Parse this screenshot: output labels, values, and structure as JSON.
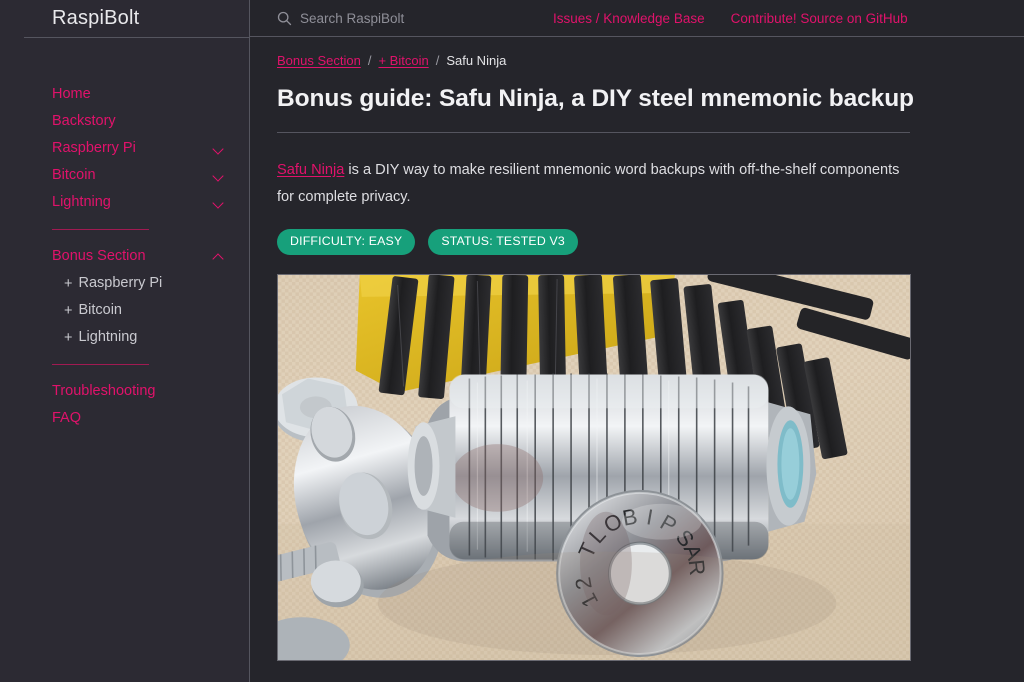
{
  "sidebar": {
    "brand": "RaspiBolt",
    "items": [
      {
        "label": "Home",
        "chevron": "none"
      },
      {
        "label": "Backstory",
        "chevron": "none"
      },
      {
        "label": "Raspberry Pi",
        "chevron": "down"
      },
      {
        "label": "Bitcoin",
        "chevron": "down"
      },
      {
        "label": "Lightning",
        "chevron": "down"
      }
    ],
    "section": {
      "label": "Bonus Section",
      "chevron": "up"
    },
    "sub_items": [
      {
        "prefix": "+",
        "label": "Raspberry Pi"
      },
      {
        "prefix": "+",
        "label": "Bitcoin"
      },
      {
        "prefix": "+",
        "label": "Lightning"
      }
    ],
    "footer_items": [
      {
        "label": "Troubleshooting"
      },
      {
        "label": "FAQ"
      }
    ]
  },
  "topbar": {
    "search_placeholder": "Search RaspiBolt",
    "search_value": "",
    "search_icon": "search-icon",
    "links": [
      {
        "label": "Issues / Knowledge Base"
      },
      {
        "label": "Contribute! Source on GitHub"
      }
    ]
  },
  "breadcrumb": {
    "items": [
      {
        "label": "Bonus Section",
        "link": true
      },
      {
        "label": "+ Bitcoin",
        "link": true
      },
      {
        "label": "Safu Ninja",
        "link": false
      }
    ],
    "separator": "/"
  },
  "article": {
    "title": "Bonus guide: Safu Ninja, a DIY steel mnemonic backup",
    "lead_link": "Safu Ninja",
    "lead_rest": " is a DIY way to make resilient mnemonic word backups with off-the-shelf components for complete privacy.",
    "badges": [
      {
        "label": "DIFFICULTY: EASY",
        "color": "#17a07b"
      },
      {
        "label": "STATUS: TESTED V3",
        "color": "#17a07b"
      }
    ],
    "photo_alt": "Stamped steel washers reading RASPIBOLT 21 with letter punch set, bolt and nut on canvas"
  },
  "colors": {
    "accent_pink": "#e1126b",
    "sidebar_bg": "#2c2a33",
    "main_bg": "#25252b",
    "badge_green": "#17a07b",
    "text": "#dedee2"
  }
}
